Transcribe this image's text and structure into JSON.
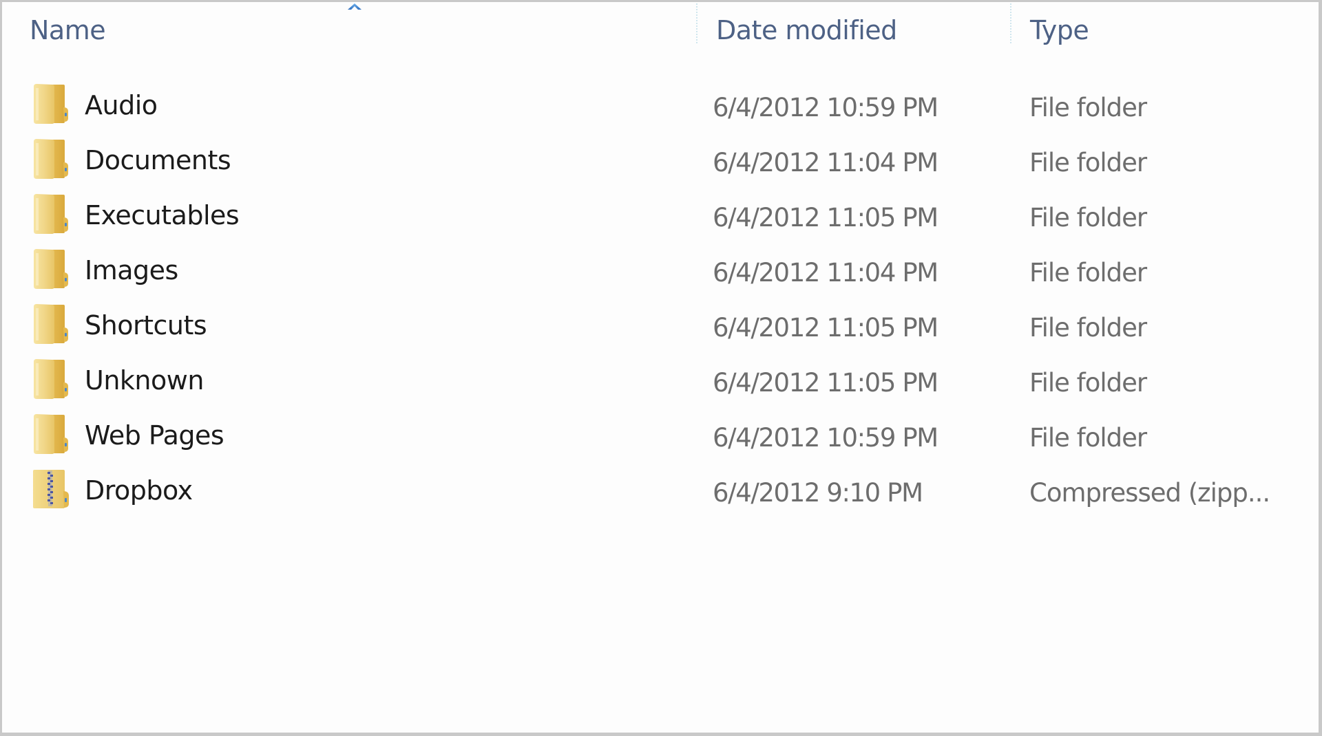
{
  "columns": {
    "name": "Name",
    "date_modified": "Date modified",
    "type": "Type",
    "sort_column": "Name",
    "sort_direction": "ascending"
  },
  "colors": {
    "header_text": "#4d6185",
    "name_text": "#1b1b1b",
    "detail_text": "#6d6d6d",
    "sort_arrow": "#3a7fd0",
    "folder": "#ecc96a"
  },
  "items": [
    {
      "name": "Audio",
      "date": "6/4/2012 10:59 PM",
      "type": "File folder",
      "icon": "folder-icon"
    },
    {
      "name": "Documents",
      "date": "6/4/2012 11:04 PM",
      "type": "File folder",
      "icon": "folder-icon"
    },
    {
      "name": "Executables",
      "date": "6/4/2012 11:05 PM",
      "type": "File folder",
      "icon": "folder-icon"
    },
    {
      "name": "Images",
      "date": "6/4/2012 11:04 PM",
      "type": "File folder",
      "icon": "folder-icon"
    },
    {
      "name": "Shortcuts",
      "date": "6/4/2012 11:05 PM",
      "type": "File folder",
      "icon": "folder-icon"
    },
    {
      "name": "Unknown",
      "date": "6/4/2012 11:05 PM",
      "type": "File folder",
      "icon": "folder-icon"
    },
    {
      "name": "Web Pages",
      "date": "6/4/2012 10:59 PM",
      "type": "File folder",
      "icon": "folder-icon"
    },
    {
      "name": "Dropbox",
      "date": "6/4/2012 9:10 PM",
      "type": "Compressed (zipp...",
      "icon": "zip-folder-icon"
    }
  ]
}
